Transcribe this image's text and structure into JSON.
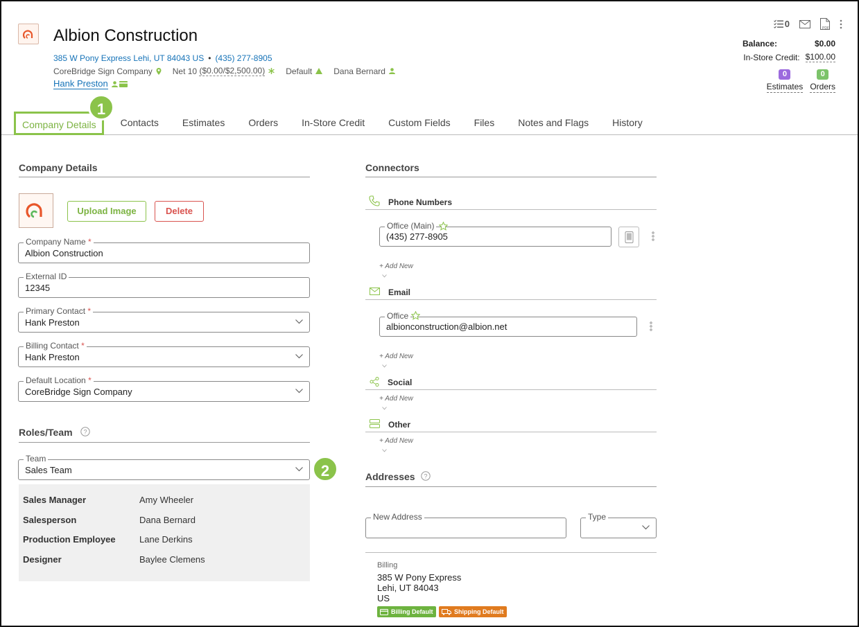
{
  "company": {
    "name": "Albion Construction",
    "address": "385 W Pony Express Lehi, UT 84043 US",
    "separator": "•",
    "phone": "(435) 277-8905",
    "location": "CoreBridge Sign Company",
    "terms": "Net 10",
    "terms_amount": "($0.00/$2,500.00)",
    "pricing": "Default",
    "salesperson": "Dana Bernard",
    "contact": "Hank Preston"
  },
  "top_actions": {
    "tasks_count": "0",
    "pdf_label": "PDF"
  },
  "balance": {
    "label": "Balance:",
    "value": "$0.00"
  },
  "store_credit": {
    "label": "In-Store Credit:",
    "value": "$100.00"
  },
  "counts": {
    "estimates": {
      "count": "0",
      "label": "Estimates",
      "color": "#9c6ade"
    },
    "orders": {
      "count": "0",
      "label": "Orders",
      "color": "#7cc36a"
    }
  },
  "tabs": [
    {
      "label": "Company Details"
    },
    {
      "label": "Contacts"
    },
    {
      "label": "Estimates"
    },
    {
      "label": "Orders"
    },
    {
      "label": "In-Store Credit"
    },
    {
      "label": "Custom Fields"
    },
    {
      "label": "Files"
    },
    {
      "label": "Notes and Flags"
    },
    {
      "label": "History"
    }
  ],
  "callouts": {
    "one": "1",
    "two": "2"
  },
  "details": {
    "heading": "Company Details",
    "upload_label": "Upload Image",
    "delete_label": "Delete",
    "fields": {
      "company_name": {
        "label": "Company Name",
        "value": "Albion Construction",
        "required": "*"
      },
      "external_id": {
        "label": "External ID",
        "value": "12345"
      },
      "primary_contact": {
        "label": "Primary Contact",
        "value": "Hank Preston",
        "required": "*"
      },
      "billing_contact": {
        "label": "Billing Contact",
        "value": "Hank Preston",
        "required": "*"
      },
      "default_location": {
        "label": "Default Location",
        "value": "CoreBridge Sign Company",
        "required": "*"
      }
    }
  },
  "roles": {
    "heading": "Roles/Team",
    "team_label": "Team",
    "team_value": "Sales Team",
    "rows": [
      {
        "role": "Sales Manager",
        "name": "Amy Wheeler"
      },
      {
        "role": "Salesperson",
        "name": "Dana Bernard"
      },
      {
        "role": "Production Employee",
        "name": "Lane Derkins"
      },
      {
        "role": "Designer",
        "name": "Baylee Clemens"
      }
    ]
  },
  "connectors": {
    "heading": "Connectors",
    "add_new": "+ Add New",
    "phone": {
      "heading": "Phone Numbers",
      "label": "Office (Main)",
      "value": "(435) 277-8905"
    },
    "email": {
      "heading": "Email",
      "label": "Office",
      "value": "albionconstruction@albion.net"
    },
    "social": {
      "heading": "Social"
    },
    "other": {
      "heading": "Other"
    }
  },
  "addresses": {
    "heading": "Addresses",
    "new_label": "New Address",
    "type_label": "Type",
    "billing": {
      "label": "Billing",
      "line1": "385 W Pony Express",
      "line2": "Lehi, UT 84043",
      "line3": "US",
      "badge_billing": "Billing Default",
      "badge_shipping": "Shipping Default"
    }
  },
  "colors": {
    "accent": "#8bc34a",
    "link": "#1673b8",
    "danger": "#d9534f",
    "shipping": "#e07b1f"
  }
}
